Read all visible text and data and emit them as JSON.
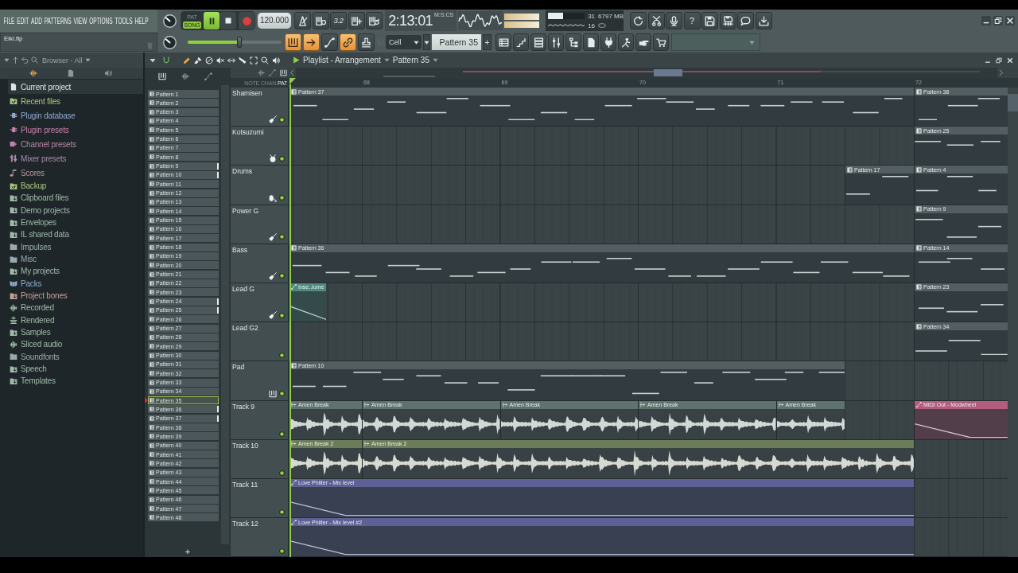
{
  "menu": [
    "FILE",
    "EDIT",
    "ADD",
    "PATTERNS",
    "VIEW",
    "OPTIONS",
    "TOOLS",
    "HELP"
  ],
  "hint": "Eiki.flp",
  "transport": {
    "modes": [
      {
        "label": "PAT",
        "selected": false
      },
      {
        "label": "SONG",
        "selected": true
      }
    ],
    "playing": true,
    "tempo": "120.000"
  },
  "recording": {
    "countdown": "3.2"
  },
  "time": {
    "value": "2:13:01",
    "unit": "M:S:CS"
  },
  "monitor": {
    "cpu": {
      "reading": "31",
      "level": 0.4
    },
    "memory": "6797 MB",
    "polyphony": "16"
  },
  "tools": {
    "help": "?"
  },
  "master_slider": {
    "level": 0.55
  },
  "mode_buttons": [
    {
      "on": true
    },
    {
      "on": true
    },
    {
      "on": false
    },
    {
      "on": true
    },
    {
      "on": false
    }
  ],
  "snap": {
    "value": "Cell"
  },
  "pattern_selector": {
    "value": "Pattern 35",
    "add": "+"
  },
  "browser": {
    "title": "Browser - All",
    "items": [
      {
        "label": "Current project",
        "kind": "file",
        "color": "#dfe3e0",
        "selected": true
      },
      {
        "label": "Recent files",
        "kind": "recent",
        "color": "#a9c97a",
        "selected": false
      },
      {
        "label": "Plugin database",
        "kind": "plugin",
        "color": "#8fabd3",
        "selected": false
      },
      {
        "label": "Plugin presets",
        "kind": "plugin",
        "color": "#c97faa",
        "selected": false
      },
      {
        "label": "Channel presets",
        "kind": "channel",
        "color": "#bb86a8",
        "selected": false
      },
      {
        "label": "Mixer presets",
        "kind": "mixer",
        "color": "#aa88b0",
        "selected": false
      },
      {
        "label": "Scores",
        "kind": "score",
        "color": "#b894a4",
        "selected": false
      },
      {
        "label": "Backup",
        "kind": "recent",
        "color": "#a9c97a",
        "selected": false
      },
      {
        "label": "Clipboard files",
        "kind": "link",
        "color": "#9fbaa8",
        "selected": false
      },
      {
        "label": "Demo projects",
        "kind": "link",
        "color": "#9fbaa8",
        "selected": false
      },
      {
        "label": "Envelopes",
        "kind": "link",
        "color": "#9fbaa8",
        "selected": false
      },
      {
        "label": "IL shared data",
        "kind": "link",
        "color": "#9fbaa8",
        "selected": false
      },
      {
        "label": "Impulses",
        "kind": "folder",
        "color": "#9aaaac",
        "selected": false
      },
      {
        "label": "Misc",
        "kind": "folder",
        "color": "#9aaaac",
        "selected": false
      },
      {
        "label": "My projects",
        "kind": "link",
        "color": "#9fbaa8",
        "selected": false
      },
      {
        "label": "Packs",
        "kind": "pack",
        "color": "#8fabd3",
        "selected": false
      },
      {
        "label": "Project bones",
        "kind": "link",
        "color": "#c3a096",
        "selected": false
      },
      {
        "label": "Recorded",
        "kind": "audio",
        "color": "#9fbaa8",
        "selected": false
      },
      {
        "label": "Rendered",
        "kind": "render",
        "color": "#9fbaa8",
        "selected": false
      },
      {
        "label": "Samples",
        "kind": "link",
        "color": "#9fbaa8",
        "selected": false
      },
      {
        "label": "Sliced audio",
        "kind": "audio",
        "color": "#9fbaa8",
        "selected": false
      },
      {
        "label": "Soundfonts",
        "kind": "folder",
        "color": "#9aaaac",
        "selected": false
      },
      {
        "label": "Speech",
        "kind": "link",
        "color": "#9fbaa8",
        "selected": false
      },
      {
        "label": "Templates",
        "kind": "link",
        "color": "#9fbaa8",
        "selected": false
      }
    ]
  },
  "playlist": {
    "title": "Playlist - Arrangement",
    "pattern": "Pattern 35",
    "patterns": [
      {
        "name": "Pattern 1",
        "selected": false,
        "marked": false
      },
      {
        "name": "Pattern 2",
        "selected": false,
        "marked": false
      },
      {
        "name": "Pattern 3",
        "selected": false,
        "marked": false
      },
      {
        "name": "Pattern 4",
        "selected": false,
        "marked": false
      },
      {
        "name": "Pattern 5",
        "selected": false,
        "marked": false
      },
      {
        "name": "Pattern 6",
        "selected": false,
        "marked": false
      },
      {
        "name": "Pattern 7",
        "selected": false,
        "marked": false
      },
      {
        "name": "Pattern 8",
        "selected": false,
        "marked": false
      },
      {
        "name": "Pattern 9",
        "selected": false,
        "marked": true
      },
      {
        "name": "Pattern 10",
        "selected": false,
        "marked": true
      },
      {
        "name": "Pattern 11",
        "selected": false,
        "marked": false
      },
      {
        "name": "Pattern 12",
        "selected": false,
        "marked": false
      },
      {
        "name": "Pattern 13",
        "selected": false,
        "marked": false
      },
      {
        "name": "Pattern 14",
        "selected": false,
        "marked": false
      },
      {
        "name": "Pattern 15",
        "selected": false,
        "marked": false
      },
      {
        "name": "Pattern 16",
        "selected": false,
        "marked": false
      },
      {
        "name": "Pattern 17",
        "selected": false,
        "marked": false
      },
      {
        "name": "Pattern 18",
        "selected": false,
        "marked": false
      },
      {
        "name": "Pattern 19",
        "selected": false,
        "marked": false
      },
      {
        "name": "Pattern 20",
        "selected": false,
        "marked": false
      },
      {
        "name": "Pattern 21",
        "selected": false,
        "marked": false
      },
      {
        "name": "Pattern 22",
        "selected": false,
        "marked": false
      },
      {
        "name": "Pattern 23",
        "selected": false,
        "marked": false
      },
      {
        "name": "Pattern 24",
        "selected": false,
        "marked": true
      },
      {
        "name": "Pattern 25",
        "selected": false,
        "marked": true
      },
      {
        "name": "Pattern 26",
        "selected": false,
        "marked": false
      },
      {
        "name": "Pattern 27",
        "selected": false,
        "marked": false
      },
      {
        "name": "Pattern 28",
        "selected": false,
        "marked": false
      },
      {
        "name": "Pattern 29",
        "selected": false,
        "marked": false
      },
      {
        "name": "Pattern 30",
        "selected": false,
        "marked": false
      },
      {
        "name": "Pattern 31",
        "selected": false,
        "marked": false
      },
      {
        "name": "Pattern 32",
        "selected": false,
        "marked": false
      },
      {
        "name": "Pattern 33",
        "selected": false,
        "marked": false
      },
      {
        "name": "Pattern 34",
        "selected": false,
        "marked": false
      },
      {
        "name": "Pattern 35",
        "selected": true,
        "marked": false
      },
      {
        "name": "Pattern 36",
        "selected": false,
        "marked": true
      },
      {
        "name": "Pattern 37",
        "selected": false,
        "marked": true
      },
      {
        "name": "Pattern 38",
        "selected": false,
        "marked": false
      },
      {
        "name": "Pattern 39",
        "selected": false,
        "marked": false
      },
      {
        "name": "Pattern 40",
        "selected": false,
        "marked": false
      },
      {
        "name": "Pattern 41",
        "selected": false,
        "marked": false
      },
      {
        "name": "Pattern 42",
        "selected": false,
        "marked": false
      },
      {
        "name": "Pattern 43",
        "selected": false,
        "marked": false
      },
      {
        "name": "Pattern 44",
        "selected": false,
        "marked": false
      },
      {
        "name": "Pattern 45",
        "selected": false,
        "marked": false
      },
      {
        "name": "Pattern 46",
        "selected": false,
        "marked": false
      },
      {
        "name": "Pattern 47",
        "selected": false,
        "marked": false
      },
      {
        "name": "Pattern 48",
        "selected": false,
        "marked": false
      }
    ],
    "add": "+",
    "snap_modes": [
      {
        "label": "NOTE",
        "selected": false
      },
      {
        "label": "CHAN",
        "selected": false
      },
      {
        "label": "PAT",
        "selected": true
      }
    ],
    "ruler": [
      "68",
      "69",
      "70",
      "71",
      "72"
    ],
    "tracks": [
      {
        "name": "Shamisen",
        "kind": "guitar",
        "enabled": true,
        "clips": [
          {
            "label": "Pattern 37",
            "kind": "pattern",
            "color": "#535e62"
          },
          {
            "label": "Pattern 38",
            "kind": "pattern",
            "color": "#535e62"
          }
        ]
      },
      {
        "name": "Kotsuzumi",
        "kind": "drum",
        "enabled": true,
        "clips": [
          {
            "label": "Pattern 25",
            "kind": "pattern",
            "color": "#535e62"
          }
        ]
      },
      {
        "name": "Drums",
        "kind": "kit",
        "enabled": true,
        "clips": [
          {
            "label": "Pattern 17",
            "kind": "pattern",
            "color": "#535e62"
          },
          {
            "label": "Pattern 4",
            "kind": "pattern",
            "color": "#535e62"
          }
        ]
      },
      {
        "name": "Power G",
        "kind": "guitar",
        "enabled": true,
        "clips": [
          {
            "label": "Pattern 9",
            "kind": "pattern",
            "color": "#535e62"
          }
        ]
      },
      {
        "name": "Bass",
        "kind": "guitar",
        "enabled": true,
        "clips": [
          {
            "label": "Pattern 36",
            "kind": "pattern",
            "color": "#535e62"
          },
          {
            "label": "Pattern 14",
            "kind": "pattern",
            "color": "#535e62"
          }
        ]
      },
      {
        "name": "Lead G",
        "kind": "guitar",
        "enabled": true,
        "clips": [
          {
            "label": "Inse..lume",
            "kind": "automation",
            "color": "#4e8a80"
          },
          {
            "label": "Pattern 23",
            "kind": "pattern",
            "color": "#535e62"
          }
        ]
      },
      {
        "name": "Lead G2",
        "kind": "plain",
        "enabled": true,
        "clips": [
          {
            "label": "Pattern 34",
            "kind": "pattern",
            "color": "#535e62"
          }
        ]
      },
      {
        "name": "Pad",
        "kind": "keys",
        "enabled": true,
        "clips": [
          {
            "label": "Pattern 10",
            "kind": "pattern",
            "color": "#535e62"
          }
        ]
      },
      {
        "name": "Track 9",
        "kind": "plain",
        "enabled": true,
        "clips": [
          {
            "label": "Amen Break",
            "kind": "audio",
            "color": "#5e736d"
          },
          {
            "label": "Amen Break",
            "kind": "audio",
            "color": "#5e736d"
          },
          {
            "label": "Amen Break",
            "kind": "audio",
            "color": "#5e736d"
          },
          {
            "label": "Amen Break",
            "kind": "audio",
            "color": "#5e736d"
          },
          {
            "label": "Amen Break",
            "kind": "audio",
            "color": "#5e736d"
          },
          {
            "label": "MIDI Out - Modwheel",
            "kind": "automation",
            "color": "#b45c7c"
          }
        ]
      },
      {
        "name": "Track 10",
        "kind": "plain",
        "enabled": true,
        "clips": [
          {
            "label": "Amen Break 2",
            "kind": "audio",
            "color": "#6b7c59"
          },
          {
            "label": "Amen Break 2",
            "kind": "audio",
            "color": "#6b7c59"
          }
        ]
      },
      {
        "name": "Track 11",
        "kind": "plain",
        "enabled": true,
        "clips": [
          {
            "label": "Love Philter - Mix level",
            "kind": "automation",
            "color": "#5d6196"
          }
        ]
      },
      {
        "name": "Track 12",
        "kind": "plain",
        "enabled": true,
        "clips": [
          {
            "label": "Love Philter - Mix level #2",
            "kind": "automation",
            "color": "#5d6196"
          }
        ]
      }
    ]
  }
}
